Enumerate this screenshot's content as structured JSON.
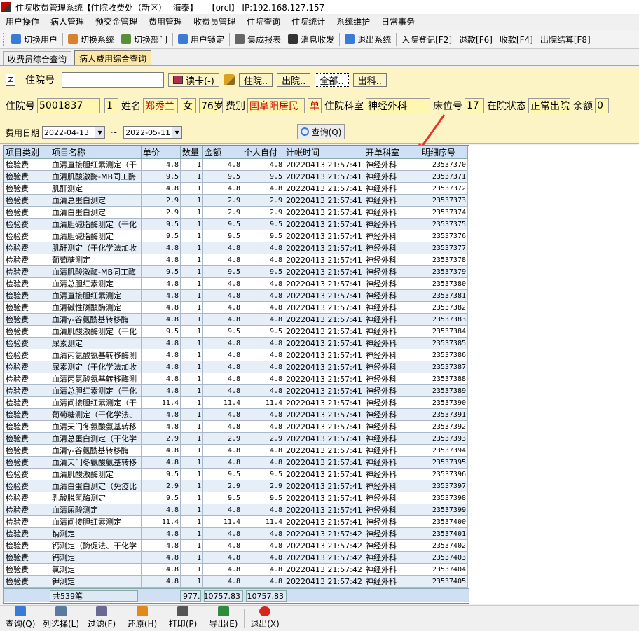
{
  "window": {
    "title": "住院收费管理系统【住院收费处（新区）--海泰】---【orcl】 IP:192.168.127.157"
  },
  "menu": [
    "用户操作",
    "病人管理",
    "预交金管理",
    "费用管理",
    "收费员管理",
    "住院查询",
    "住院统计",
    "系统维护",
    "日常事务"
  ],
  "toolbar": [
    {
      "label": "切换用户",
      "icon": "user-switch-icon",
      "color": "#3a7bd5"
    },
    {
      "label": "切换系统",
      "icon": "system-switch-icon",
      "color": "#d9822b"
    },
    {
      "label": "切换部门",
      "icon": "dept-switch-icon",
      "color": "#5a8f3a"
    },
    {
      "label": "用户锁定",
      "icon": "lock-user-icon",
      "color": "#3a7bd5"
    },
    {
      "label": "集成报表",
      "icon": "report-icon",
      "color": "#666"
    },
    {
      "label": "消息收发",
      "icon": "message-icon",
      "color": "#333"
    },
    {
      "label": "退出系统",
      "icon": "exit-icon",
      "color": "#3a7bd5"
    },
    {
      "label": "入院登记[F2]",
      "icon": "",
      "color": ""
    },
    {
      "label": "退款[F6]",
      "icon": "",
      "color": ""
    },
    {
      "label": "收款[F4]",
      "icon": "",
      "color": ""
    },
    {
      "label": "出院结算[F8]",
      "icon": "",
      "color": ""
    }
  ],
  "tabs": [
    "收费员综合查询",
    "病人费用综合查询"
  ],
  "search": {
    "z_label": "Z",
    "inpatient_label": "住院号",
    "inpatient_value": "",
    "read_card": "读卡(-)",
    "btn_in": "住院..",
    "btn_out": "出院..",
    "btn_all": "全部..",
    "btn_dept_out": "出科.."
  },
  "patient": {
    "id_label": "住院号",
    "id": "5001837",
    "bed_seq": "1",
    "name_label": "姓名",
    "name": "郑秀兰",
    "sex": "女",
    "age": "76岁",
    "fee_label": "费别",
    "fee_type": "国阜阳居民",
    "single": "单",
    "dept_label": "住院科室",
    "dept": "神经外科",
    "bed_label": "床位号",
    "bed": "17",
    "status_label": "在院状态",
    "status": "正常出院",
    "balance_label": "余额",
    "balance": "0"
  },
  "date_filter": {
    "label": "费用日期",
    "from": "2022-04-13",
    "sep": "~",
    "to": "2022-05-11",
    "query": "查询(Q)"
  },
  "table": {
    "headers": [
      "项目类别",
      "项目名称",
      "单价",
      "数量",
      "金额",
      "个人自付",
      "计帐时间",
      "开单科室",
      "明细序号"
    ],
    "rows": [
      [
        "检验费",
        "血清直接胆红素测定（干",
        "4.8",
        "1",
        "4.8",
        "4.8",
        "20220413 21:57:41",
        "神经外科",
        "23537370"
      ],
      [
        "检验费",
        "血清肌酸激酶-MB同工酶",
        "9.5",
        "1",
        "9.5",
        "9.5",
        "20220413 21:57:41",
        "神经外科",
        "23537371"
      ],
      [
        "检验费",
        "肌酐测定",
        "4.8",
        "1",
        "4.8",
        "4.8",
        "20220413 21:57:41",
        "神经外科",
        "23537372"
      ],
      [
        "检验费",
        "血清总蛋白测定",
        "2.9",
        "1",
        "2.9",
        "2.9",
        "20220413 21:57:41",
        "神经外科",
        "23537373"
      ],
      [
        "检验费",
        "血清白蛋白测定",
        "2.9",
        "1",
        "2.9",
        "2.9",
        "20220413 21:57:41",
        "神经外科",
        "23537374"
      ],
      [
        "检验费",
        "血清胆碱脂酶测定（干化",
        "9.5",
        "1",
        "9.5",
        "9.5",
        "20220413 21:57:41",
        "神经外科",
        "23537375"
      ],
      [
        "检验费",
        "血清胆碱脂酶测定",
        "9.5",
        "1",
        "9.5",
        "9.5",
        "20220413 21:57:41",
        "神经外科",
        "23537376"
      ],
      [
        "检验费",
        "肌酐测定（干化学法加收",
        "4.8",
        "1",
        "4.8",
        "4.8",
        "20220413 21:57:41",
        "神经外科",
        "23537377"
      ],
      [
        "检验费",
        "葡萄糖测定",
        "4.8",
        "1",
        "4.8",
        "4.8",
        "20220413 21:57:41",
        "神经外科",
        "23537378"
      ],
      [
        "检验费",
        "血清肌酸激酶-MB同工酶",
        "9.5",
        "1",
        "9.5",
        "9.5",
        "20220413 21:57:41",
        "神经外科",
        "23537379"
      ],
      [
        "检验费",
        "血清总胆红素测定",
        "4.8",
        "1",
        "4.8",
        "4.8",
        "20220413 21:57:41",
        "神经外科",
        "23537380"
      ],
      [
        "检验费",
        "血清直接胆红素测定",
        "4.8",
        "1",
        "4.8",
        "4.8",
        "20220413 21:57:41",
        "神经外科",
        "23537381"
      ],
      [
        "检验费",
        "血清碱性磷酸酶测定",
        "4.8",
        "1",
        "4.8",
        "4.8",
        "20220413 21:57:41",
        "神经外科",
        "23537382"
      ],
      [
        "检验费",
        "血清γ-谷氨酰基转移酶",
        "4.8",
        "1",
        "4.8",
        "4.8",
        "20220413 21:57:41",
        "神经外科",
        "23537383"
      ],
      [
        "检验费",
        "血清肌酸激酶测定（干化",
        "9.5",
        "1",
        "9.5",
        "9.5",
        "20220413 21:57:41",
        "神经外科",
        "23537384"
      ],
      [
        "检验费",
        "尿素测定",
        "4.8",
        "1",
        "4.8",
        "4.8",
        "20220413 21:57:41",
        "神经外科",
        "23537385"
      ],
      [
        "检验费",
        "血清丙氨酸氨基转移酶测",
        "4.8",
        "1",
        "4.8",
        "4.8",
        "20220413 21:57:41",
        "神经外科",
        "23537386"
      ],
      [
        "检验费",
        "尿素测定（干化学法加收",
        "4.8",
        "1",
        "4.8",
        "4.8",
        "20220413 21:57:41",
        "神经外科",
        "23537387"
      ],
      [
        "检验费",
        "血清丙氨酸氨基转移酶测",
        "4.8",
        "1",
        "4.8",
        "4.8",
        "20220413 21:57:41",
        "神经外科",
        "23537388"
      ],
      [
        "检验费",
        "血清总胆红素测定（干化",
        "4.8",
        "1",
        "4.8",
        "4.8",
        "20220413 21:57:41",
        "神经外科",
        "23537389"
      ],
      [
        "检验费",
        "血清间接胆红素测定（干",
        "11.4",
        "1",
        "11.4",
        "11.4",
        "20220413 21:57:41",
        "神经外科",
        "23537390"
      ],
      [
        "检验费",
        "葡萄糖测定（干化学法、",
        "4.8",
        "1",
        "4.8",
        "4.8",
        "20220413 21:57:41",
        "神经外科",
        "23537391"
      ],
      [
        "检验费",
        "血清天门冬氨酸氨基转移",
        "4.8",
        "1",
        "4.8",
        "4.8",
        "20220413 21:57:41",
        "神经外科",
        "23537392"
      ],
      [
        "检验费",
        "血清总蛋白测定（干化学",
        "2.9",
        "1",
        "2.9",
        "2.9",
        "20220413 21:57:41",
        "神经外科",
        "23537393"
      ],
      [
        "检验费",
        "血清γ-谷氨酰基转移酶",
        "4.8",
        "1",
        "4.8",
        "4.8",
        "20220413 21:57:41",
        "神经外科",
        "23537394"
      ],
      [
        "检验费",
        "血清天门冬氨酸氨基转移",
        "4.8",
        "1",
        "4.8",
        "4.8",
        "20220413 21:57:41",
        "神经外科",
        "23537395"
      ],
      [
        "检验费",
        "血清肌酸激酶测定",
        "9.5",
        "1",
        "9.5",
        "9.5",
        "20220413 21:57:41",
        "神经外科",
        "23537396"
      ],
      [
        "检验费",
        "血清白蛋白测定（免疫比",
        "2.9",
        "1",
        "2.9",
        "2.9",
        "20220413 21:57:41",
        "神经外科",
        "23537397"
      ],
      [
        "检验费",
        "乳酸脱氢酶测定",
        "9.5",
        "1",
        "9.5",
        "9.5",
        "20220413 21:57:41",
        "神经外科",
        "23537398"
      ],
      [
        "检验费",
        "血清尿酸测定",
        "4.8",
        "1",
        "4.8",
        "4.8",
        "20220413 21:57:41",
        "神经外科",
        "23537399"
      ],
      [
        "检验费",
        "血清间接胆红素测定",
        "11.4",
        "1",
        "11.4",
        "11.4",
        "20220413 21:57:41",
        "神经外科",
        "23537400"
      ],
      [
        "检验费",
        "钠测定",
        "4.8",
        "1",
        "4.8",
        "4.8",
        "20220413 21:57:42",
        "神经外科",
        "23537401"
      ],
      [
        "检验费",
        "钙测定（酶促法、干化学",
        "4.8",
        "1",
        "4.8",
        "4.8",
        "20220413 21:57:42",
        "神经外科",
        "23537402"
      ],
      [
        "检验费",
        "钙测定",
        "4.8",
        "1",
        "4.8",
        "4.8",
        "20220413 21:57:42",
        "神经外科",
        "23537403"
      ],
      [
        "检验费",
        "氯测定",
        "4.8",
        "1",
        "4.8",
        "4.8",
        "20220413 21:57:42",
        "神经外科",
        "23537404"
      ],
      [
        "检验费",
        "钾测定",
        "4.8",
        "1",
        "4.8",
        "4.8",
        "20220413 21:57:42",
        "神经外科",
        "23537405"
      ]
    ]
  },
  "footer": {
    "count": "共539笔",
    "qty": "977.",
    "amount": "10757.83",
    "self_pay": "10757.83"
  },
  "bottom": [
    {
      "label": "查询(Q)",
      "icon": "refresh-icon",
      "color": "#3a7bd5"
    },
    {
      "label": "列选择(L)",
      "icon": "column-select-icon",
      "color": "#5a7aa0"
    },
    {
      "label": "过滤(F)",
      "icon": "filter-icon",
      "color": "#6a6a90"
    },
    {
      "label": "还原(H)",
      "icon": "undo-icon",
      "color": "#e08a1e"
    },
    {
      "label": "打印(P)",
      "icon": "print-icon",
      "color": "#555"
    },
    {
      "label": "导出(E)",
      "icon": "excel-icon",
      "color": "#2e8b3e"
    },
    {
      "label": "退出(X)",
      "icon": "power-icon",
      "color": "#d9261c"
    }
  ]
}
